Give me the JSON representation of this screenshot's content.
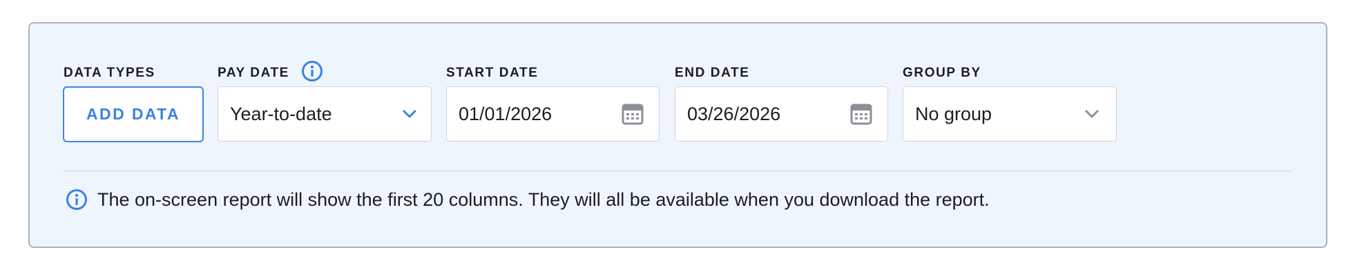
{
  "filters": {
    "data_types": {
      "label": "DATA TYPES",
      "button_label": "ADD DATA"
    },
    "pay_date": {
      "label": "PAY DATE",
      "value": "Year-to-date",
      "icon": "info-icon"
    },
    "start_date": {
      "label": "START DATE",
      "value": "01/01/2026",
      "icon": "calendar-icon"
    },
    "end_date": {
      "label": "END DATE",
      "value": "03/26/2026",
      "icon": "calendar-icon"
    },
    "group_by": {
      "label": "GROUP BY",
      "value": "No group",
      "icon": "chevron-down-icon"
    }
  },
  "notice": {
    "icon": "info-icon",
    "text": "The on-screen report will show the first 20 columns. They will all be available when you download the report."
  },
  "colors": {
    "accent": "#3b82e0",
    "panel_background": "#eff5fd",
    "text": "#1a1d22",
    "icon_gray": "#8a8f98"
  }
}
